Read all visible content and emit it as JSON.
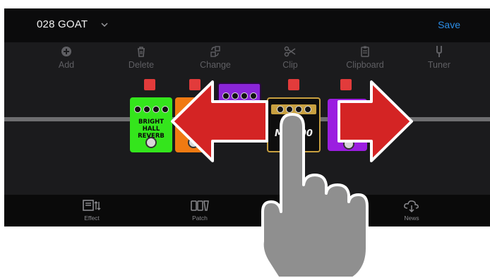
{
  "header": {
    "patch_name": "028 GOAT",
    "save_label": "Save"
  },
  "toolbar": {
    "add": "Add",
    "delete": "Delete",
    "change": "Change",
    "clip": "Clip",
    "clipboard": "Clipboard",
    "tuner": "Tuner"
  },
  "pedals": [
    {
      "label_line1": "BRIGHT HALL",
      "label_line2": "REVERB",
      "color": "#34e51c"
    },
    {
      "color": "#f07a12"
    },
    {
      "color": "#8a25d9"
    },
    {
      "label": "MS 800",
      "label_tail": "VE",
      "color": "#0e0e0e"
    },
    {
      "label": "CO",
      "color": "#9b1ee0"
    }
  ],
  "bottom_nav": {
    "effect": "Effect",
    "patch": "Patch",
    "news": "News"
  },
  "colors": {
    "accent": "#2b8de6",
    "arrow": "#d42424",
    "onoff": "#e23b3b"
  }
}
